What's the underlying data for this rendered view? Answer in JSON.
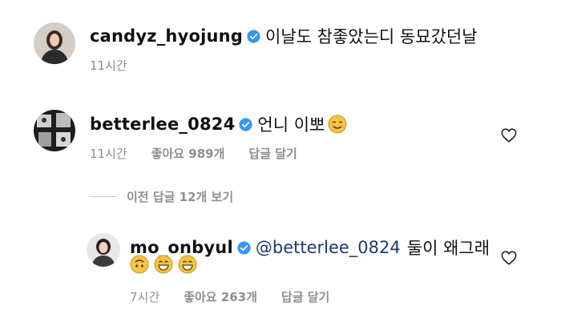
{
  "comments": [
    {
      "username": "candyz_hyojung",
      "text": "이날도 참좋았는디 동묘갔던날",
      "time": "11시간",
      "avatar": "avatar-hyojung"
    },
    {
      "username": "betterlee_0824",
      "text": "언니 이뽀",
      "emoji": "relieved-smile-emoji",
      "time": "11시간",
      "likes": "좋아요 989개",
      "reply": "답글 달기",
      "avatar": "avatar-betterlee"
    }
  ],
  "view_replies": "이전 답글 12개 보기",
  "reply_comment": {
    "username": "mo_onbyul",
    "mention": "@betterlee_0824",
    "text": "둘이 왜그래",
    "emojis": [
      "upside-down-face-emoji",
      "grinning-face-emoji",
      "grinning-face-emoji"
    ],
    "time": "7시간",
    "likes": "좋아요 263개",
    "reply": "답글 달기",
    "avatar": "avatar-moonbyul"
  },
  "colors": {
    "verified": "#3897f0",
    "meta_text": "#8e8e8e",
    "mention": "#1c3a6b",
    "emoji": "#f4c542"
  },
  "icons": [
    "verified-badge-icon",
    "heart-icon"
  ]
}
